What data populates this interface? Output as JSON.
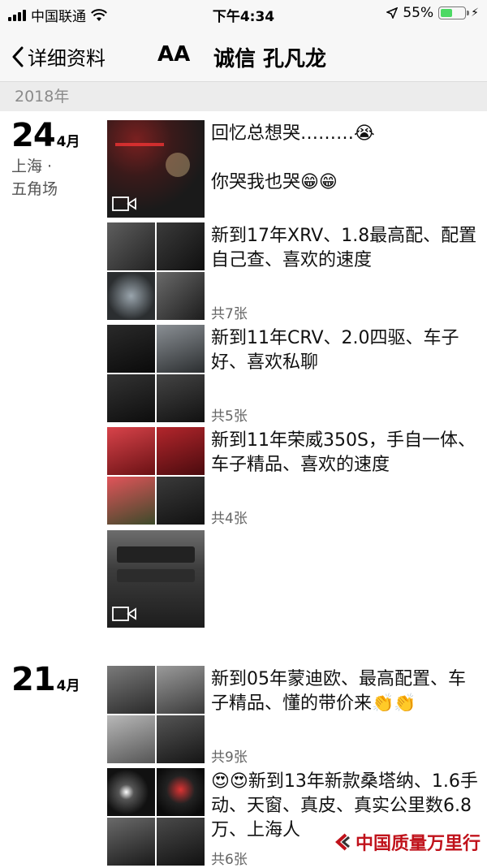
{
  "status_bar": {
    "carrier": "中国联通",
    "time": "下午4:34",
    "battery_percent": "55%",
    "battery_level": 0.55
  },
  "nav": {
    "back_label": "详细资料",
    "aa_label": "AA",
    "name": "诚信 孔凡龙"
  },
  "year_header": "2018年",
  "dates": [
    {
      "day": "24",
      "month": "4月",
      "loc1": "上海 ·",
      "loc2": "五角场"
    },
    {
      "day": "21",
      "month": "4月"
    }
  ],
  "posts": [
    {
      "text": "回忆总想哭………😭\n\n你哭我也哭😁😁",
      "count": "",
      "media": "video"
    },
    {
      "text": "新到17年XRV、1.8最高配、配置自己查、喜欢的速度",
      "count": "共7张",
      "media": "grid"
    },
    {
      "text": "新到11年CRV、2.0四驱、车子好、喜欢私聊",
      "count": "共5张",
      "media": "grid"
    },
    {
      "text": "新到11年荣威350S，手自一体、车子精品、喜欢的速度",
      "count": "共4张",
      "media": "grid"
    },
    {
      "text": "",
      "count": "",
      "media": "video"
    },
    {
      "text": "新到05年蒙迪欧、最高配置、车子精品、懂的带价来👏👏",
      "count": "共9张",
      "media": "grid"
    },
    {
      "text": "😍😍新到13年新款桑塔纳、1.6手动、天窗、真皮、真实公里数6.8万、上海人",
      "count": "共6张",
      "media": "grid"
    }
  ],
  "watermark": "中国质量万里行",
  "colors": {
    "bar_bg": "#f7f7f7",
    "year_bg": "#ececec",
    "battery_green": "#4cd964",
    "watermark_red": "#c0121b"
  }
}
